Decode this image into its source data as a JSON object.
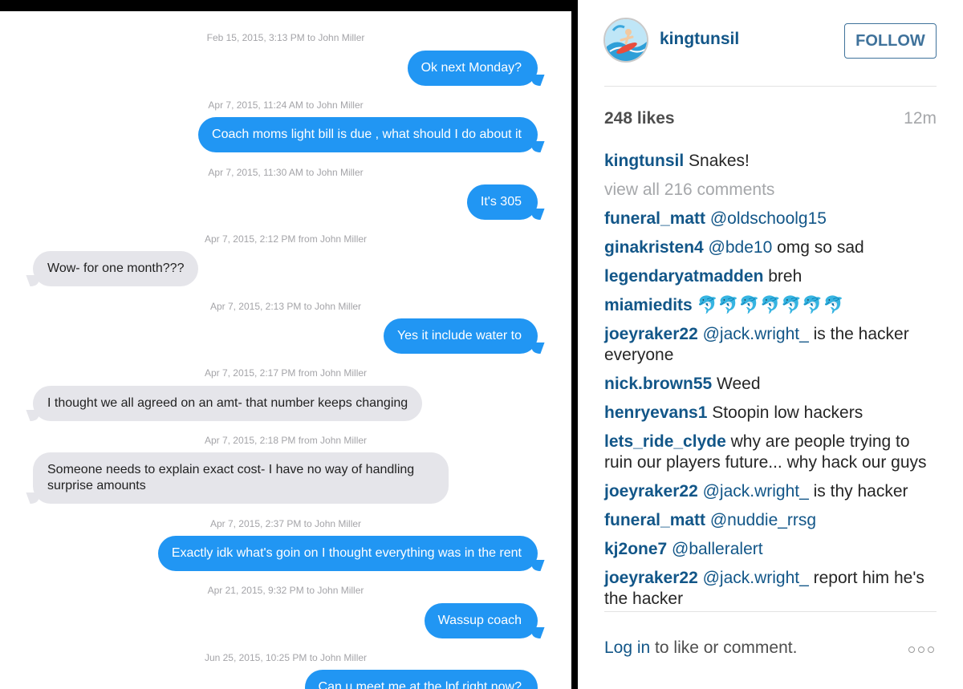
{
  "messages": {
    "items": [
      {
        "timestamp": "Feb 15, 2015, 3:13 PM to John Miller",
        "text": "Ok next Monday?"
      },
      {
        "timestamp": "Apr 7, 2015, 11:24 AM to John Miller",
        "text": "Coach moms light bill is due , what should I do about it"
      },
      {
        "timestamp": "Apr 7, 2015, 11:30 AM to John Miller",
        "text": "It's 305"
      },
      {
        "timestamp": "Apr 7, 2015, 2:12 PM from John Miller",
        "text": "Wow- for one month???"
      },
      {
        "timestamp": "Apr 7, 2015, 2:13 PM to John Miller",
        "text": "Yes it include water to"
      },
      {
        "timestamp": "Apr 7, 2015, 2:17 PM from John Miller",
        "text": "I thought we all agreed on an amt- that number keeps changing"
      },
      {
        "timestamp": "Apr 7, 2015, 2:18 PM from John Miller",
        "text": "Someone needs to explain exact cost- I have no way of handling surprise amounts"
      },
      {
        "timestamp": "Apr 7, 2015, 2:37 PM to John Miller",
        "text": "Exactly idk what's goin on I thought everything was in the rent"
      },
      {
        "timestamp": "Apr 21, 2015, 9:32 PM to John Miller",
        "text": "Wassup coach"
      },
      {
        "timestamp": "Jun 25, 2015, 10:25 PM to John Miller",
        "text": "Can u meet me at the lpf right now?"
      }
    ]
  },
  "post": {
    "username": "kingtunsil",
    "follow_label": "FOLLOW",
    "likes": "248 likes",
    "age": "12m",
    "caption": {
      "user": "kingtunsil",
      "text": " Snakes!"
    },
    "view_all": "view all 216 comments",
    "comments": [
      {
        "user": "funeral_matt",
        "mention": " @oldschoolg15",
        "text": ""
      },
      {
        "user": "ginakristen4",
        "mention": " @bde10",
        "text": " omg so sad"
      },
      {
        "user": "legendaryatmadden",
        "mention": "",
        "text": " breh"
      },
      {
        "user": "miamiedits",
        "mention": "",
        "text": " 🐬🐬🐬🐬🐬🐬🐬"
      },
      {
        "user": "joeyraker22",
        "mention": " @jack.wright_",
        "text": " is the hacker everyone"
      },
      {
        "user": "nick.brown55",
        "mention": "",
        "text": " Weed"
      },
      {
        "user": "henryevans1",
        "mention": "",
        "text": " Stoopin low hackers"
      },
      {
        "user": "lets_ride_clyde",
        "mention": "",
        "text": " why are people trying to ruin our players future... why hack our guys"
      },
      {
        "user": "joeyraker22",
        "mention": " @jack.wright_",
        "text": " is thy hacker"
      },
      {
        "user": "funeral_matt",
        "mention": " @nuddie_rrsg",
        "text": ""
      },
      {
        "user": "kj2one7",
        "mention": " @balleralert",
        "text": ""
      },
      {
        "user": "joeyraker22",
        "mention": " @jack.wright_",
        "text": " report him he's the hacker"
      }
    ],
    "login_link": "Log in",
    "login_text": " to like or comment."
  },
  "colors": {
    "sent_bubble": "#2196f3",
    "received_bubble": "#e5e5ea",
    "instagram_blue": "#125688"
  }
}
